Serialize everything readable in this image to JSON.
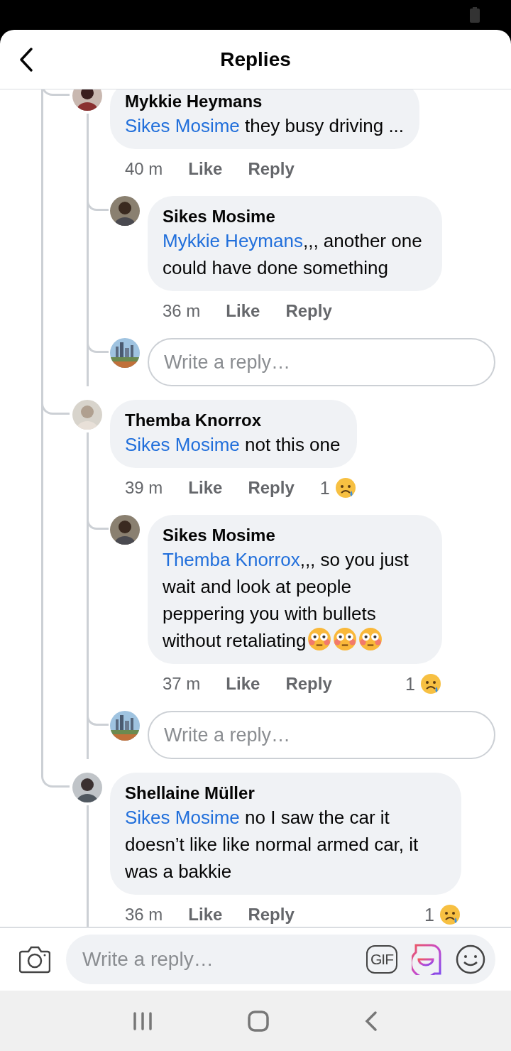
{
  "header": {
    "title": "Replies"
  },
  "thread": [
    {
      "kind": "comment",
      "name": "Mykkie Heymans",
      "mention": "Sikes Mosime",
      "text": " they busy driving ...",
      "time": "40 m",
      "like": "Like",
      "reply": "Reply",
      "children": [
        {
          "kind": "comment",
          "name": "Sikes Mosime",
          "mention": "Mykkie Heymans",
          "text": ",,, another one could have done something",
          "time": "36 m",
          "like": "Like",
          "reply": "Reply"
        },
        {
          "kind": "reply_box",
          "placeholder": "Write a reply…"
        }
      ]
    },
    {
      "kind": "comment",
      "name": "Themba Knorrox",
      "mention": "Sikes Mosime",
      "text": " not this one",
      "time": "39 m",
      "like": "Like",
      "reply": "Reply",
      "reaction": {
        "count": "1",
        "kind": "sad"
      },
      "children": [
        {
          "kind": "comment",
          "name": "Sikes Mosime",
          "mention": "Themba Knorrox",
          "text": ",,, so you just wait and look at people peppering you with bullets without retaliating",
          "emojis": [
            {
              "kind": "flushed"
            },
            {
              "kind": "flushed"
            },
            {
              "kind": "flushed"
            }
          ],
          "time": "37 m",
          "like": "Like",
          "reply": "Reply",
          "reaction": {
            "count": "1",
            "kind": "sad"
          }
        },
        {
          "kind": "reply_box",
          "placeholder": "Write a reply…"
        }
      ]
    },
    {
      "kind": "comment",
      "name": "Shellaine Müller",
      "mention": "Sikes Mosime",
      "text": " no I saw the car it doesn’t like like normal armed car, it was a bakkie",
      "time": "36 m",
      "like": "Like",
      "reply": "Reply",
      "reaction": {
        "count": "1",
        "kind": "sad"
      }
    }
  ],
  "composer": {
    "placeholder": "Write a reply…",
    "gif_label": "GIF"
  }
}
